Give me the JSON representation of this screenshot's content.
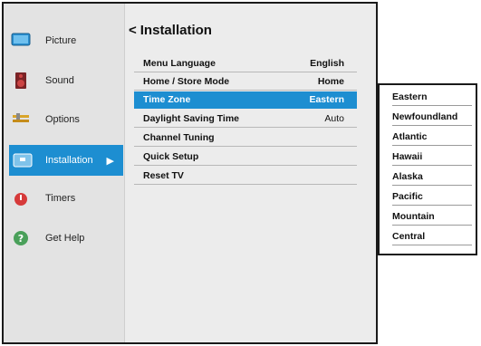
{
  "sidebar": {
    "items": [
      {
        "label": "Picture",
        "icon": "picture-icon"
      },
      {
        "label": "Sound",
        "icon": "speaker-icon"
      },
      {
        "label": "Options",
        "icon": "options-icon"
      },
      {
        "label": "Installation",
        "icon": "installation-icon",
        "active": true
      },
      {
        "label": "Timers",
        "icon": "timer-icon"
      },
      {
        "label": "Get Help",
        "icon": "help-icon"
      }
    ],
    "active_arrow": "▶"
  },
  "main": {
    "back": "<",
    "title": "Installation",
    "rows": [
      {
        "label": "Menu Language",
        "value": "English"
      },
      {
        "label": "Home / Store Mode",
        "value": "Home"
      },
      {
        "label": "Time Zone",
        "value": "Eastern",
        "selected": true
      },
      {
        "label": "Daylight Saving Time",
        "value": "Auto"
      },
      {
        "label": "Channel Tuning",
        "value": ""
      },
      {
        "label": "Quick Setup",
        "value": ""
      },
      {
        "label": "Reset TV",
        "value": ""
      }
    ]
  },
  "timezone_dropdown": {
    "options": [
      "Eastern",
      "Newfoundland",
      "Atlantic",
      "Hawaii",
      "Alaska",
      "Pacific",
      "Mountain",
      "Central"
    ]
  },
  "colors": {
    "accent": "#1d8ed1",
    "panel": "#ececec",
    "sidebar": "#e3e3e3"
  }
}
